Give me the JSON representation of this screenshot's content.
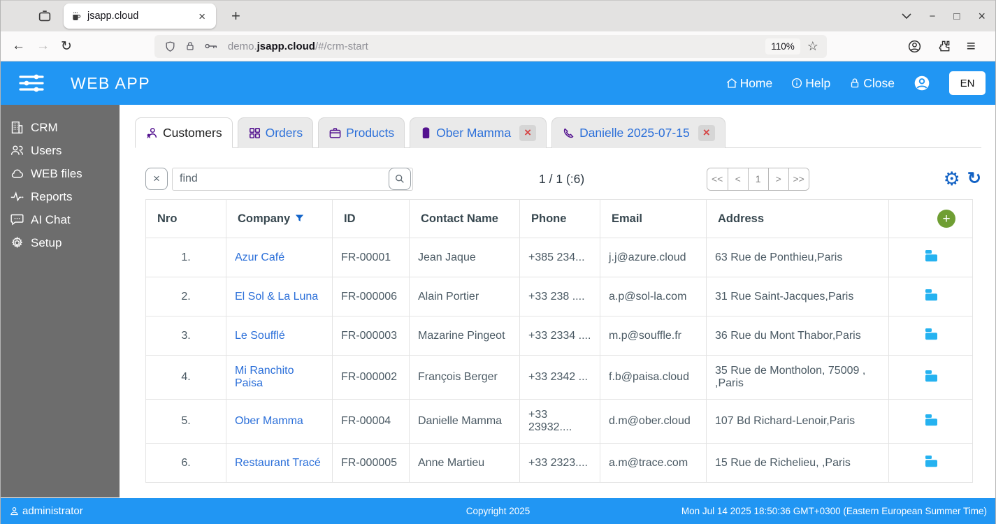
{
  "browser": {
    "tab_title": "jsapp.cloud",
    "url_prefix": "demo.",
    "url_domain": "jsapp.cloud",
    "url_path": "/#/crm-start",
    "zoom_level": "110%"
  },
  "icons": {
    "new_tab": "+",
    "tab_close": "×",
    "back": "←",
    "forward": "→",
    "reload": "↻",
    "star": "☆",
    "menu": "≡",
    "minimize": "−",
    "maximize": "□",
    "window_close": "×",
    "clear": "×",
    "gear": "⚙",
    "refresh": "↻",
    "chip_close": "×",
    "add": "+"
  },
  "header": {
    "app_title": "WEB APP",
    "nav": [
      {
        "label": "Home"
      },
      {
        "label": "Help"
      },
      {
        "label": "Close"
      }
    ],
    "language": "EN"
  },
  "sidebar": {
    "items": [
      {
        "label": "CRM"
      },
      {
        "label": "Users"
      },
      {
        "label": "WEB files"
      },
      {
        "label": "Reports"
      },
      {
        "label": "AI Chat"
      },
      {
        "label": "Setup"
      }
    ]
  },
  "tabs": [
    {
      "label": "Customers",
      "active": true
    },
    {
      "label": "Orders"
    },
    {
      "label": "Products"
    },
    {
      "label": "Ober Mamma",
      "closable": true
    },
    {
      "label": "Danielle 2025-07-15",
      "closable": true
    }
  ],
  "toolbar": {
    "find_placeholder": "find",
    "page_info": "1 / 1 (:6)",
    "pagination": [
      "<<",
      "<",
      "1",
      ">",
      ">>"
    ]
  },
  "table": {
    "columns": [
      "Nro",
      "Company",
      "ID",
      "Contact Name",
      "Phone",
      "Email",
      "Address"
    ],
    "rows": [
      {
        "nro": "1.",
        "company": "Azur Café",
        "id": "FR-00001",
        "contact": "Jean Jaque",
        "phone": "+385 234...",
        "email": "j.j@azure.cloud",
        "address": "63 Rue de Ponthieu,Paris"
      },
      {
        "nro": "2.",
        "company": "El Sol & La Luna",
        "id": "FR-000006",
        "contact": "Alain Portier",
        "phone": "+33 238 ....",
        "email": "a.p@sol-la.com",
        "address": "31 Rue Saint-Jacques,Paris"
      },
      {
        "nro": "3.",
        "company": "Le Soufflé",
        "id": "FR-000003",
        "contact": "Mazarine Pingeot",
        "phone": "+33 2334 ....",
        "email": "m.p@souffle.fr",
        "address": "36 Rue du Mont Thabor,Paris"
      },
      {
        "nro": "4.",
        "company": "Mi Ranchito Paisa",
        "id": "FR-000002",
        "contact": "François Berger",
        "phone": "+33 2342 ...",
        "email": "f.b@paisa.cloud",
        "address": "35 Rue de Montholon, 75009 , ,Paris"
      },
      {
        "nro": "5.",
        "company": "Ober Mamma",
        "id": "FR-00004",
        "contact": "Danielle Mamma",
        "phone": "+33 23932....",
        "email": "d.m@ober.cloud",
        "address": "107 Bd Richard-Lenoir,Paris"
      },
      {
        "nro": "6.",
        "company": "Restaurant Tracé",
        "id": "FR-000005",
        "contact": "Anne Martieu",
        "phone": "+33 2323....",
        "email": "a.m@trace.com",
        "address": "15 Rue de Richelieu, ,Paris"
      }
    ]
  },
  "footer": {
    "user": "administrator",
    "copyright": "Copyright 2025",
    "timestamp": "Mon Jul 14 2025 18:50:36 GMT+0300 (Eastern European Summer Time)"
  },
  "colors": {
    "accent_blue": "#2196f3",
    "sidebar_gray": "#6d6d6d",
    "link_blue": "#2b6fd9",
    "icon_purple": "#53128f",
    "folder_blue": "#25b2f0",
    "add_green": "#6f9e33",
    "tool_blue": "#1161c4",
    "close_red": "#d64545"
  }
}
